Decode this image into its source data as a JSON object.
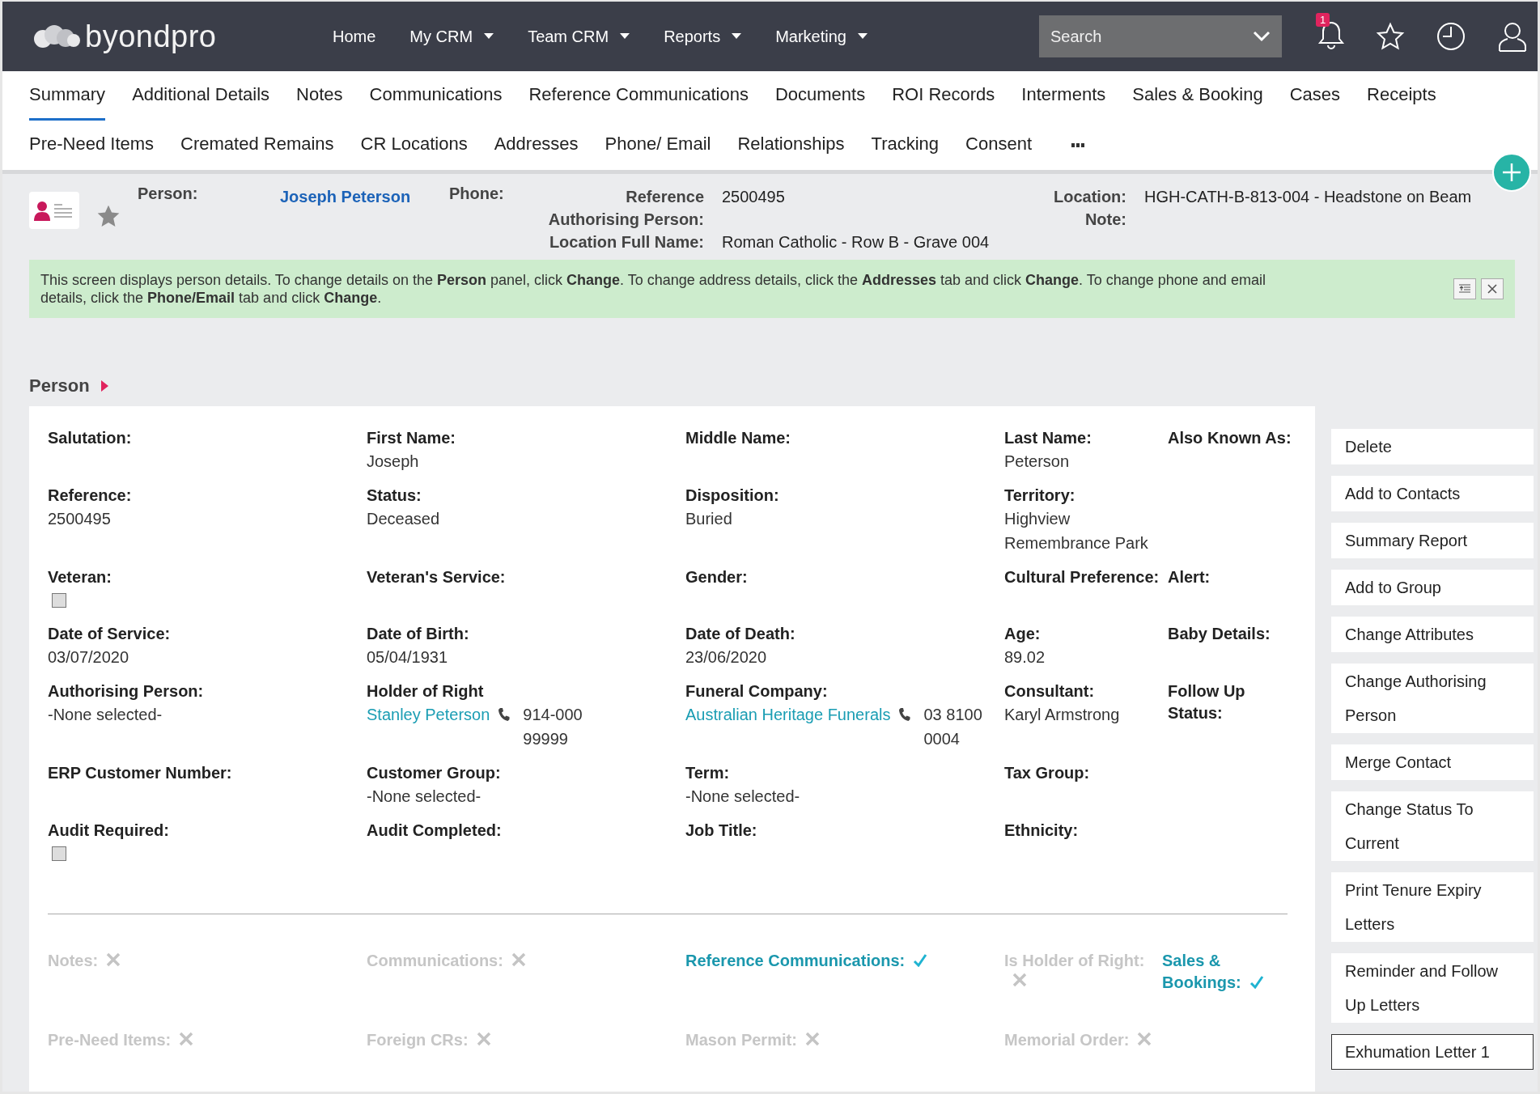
{
  "brand": {
    "name": "byondpro"
  },
  "nav": [
    {
      "label": "Home",
      "dropdown": false
    },
    {
      "label": "My CRM",
      "dropdown": true
    },
    {
      "label": "Team CRM",
      "dropdown": true
    },
    {
      "label": "Reports",
      "dropdown": true
    },
    {
      "label": "Marketing",
      "dropdown": true
    }
  ],
  "search": {
    "placeholder": "Search"
  },
  "notifications": {
    "badge": "1"
  },
  "tab_rows": [
    [
      {
        "label": "Summary",
        "selected": true
      },
      {
        "label": "Additional Details",
        "selected": false
      },
      {
        "label": "Notes",
        "selected": false
      },
      {
        "label": "Communications",
        "selected": false
      },
      {
        "label": "Reference Communications",
        "selected": false
      },
      {
        "label": "Documents",
        "selected": false
      },
      {
        "label": "ROI Records",
        "selected": false
      },
      {
        "label": "Interments",
        "selected": false
      },
      {
        "label": "Sales & Booking",
        "selected": false
      },
      {
        "label": "Cases",
        "selected": false
      },
      {
        "label": "Receipts",
        "selected": false
      }
    ],
    [
      {
        "label": "Pre-Need Items",
        "selected": false
      },
      {
        "label": "Cremated Remains",
        "selected": false
      },
      {
        "label": "CR Locations",
        "selected": false
      },
      {
        "label": "Addresses",
        "selected": false
      },
      {
        "label": "Phone/ Email",
        "selected": false
      },
      {
        "label": "Relationships",
        "selected": false
      },
      {
        "label": "Tracking",
        "selected": false
      },
      {
        "label": "Consent",
        "selected": false
      }
    ]
  ],
  "header": {
    "person_label": "Person:",
    "person_name": "Joseph Peterson",
    "phone_label": "Phone:",
    "details": [
      {
        "label": "Reference",
        "value": "2500495"
      },
      {
        "label": "Authorising Person:"
      },
      {
        "label": "Location Full Name:",
        "value": "Roman Catholic - Row B - Grave 004"
      }
    ],
    "location": [
      {
        "label": "Location:",
        "value": "HGH-CATH-B-813-004 - Headstone on Beam"
      },
      {
        "label": "Note:"
      }
    ]
  },
  "banner": {
    "text": "This screen displays person details. To change details on the **Person** panel, click **Change**. To change address details, click the **Addresses** tab and click **Change**. To change phone and email details, click the **Phone/Email** tab and click **Change**."
  },
  "section": {
    "title": "Person"
  },
  "fields": [
    [
      {
        "kind": "text",
        "label": "Salutation:"
      },
      {
        "kind": "text",
        "label": "First Name:",
        "value": "Joseph"
      },
      {
        "kind": "text",
        "label": "Middle Name:"
      },
      {
        "kind": "text",
        "label": "Last Name:",
        "value": "Peterson"
      },
      {
        "kind": "text",
        "label": "Also Known As:"
      }
    ],
    [
      {
        "kind": "text",
        "label": "Reference:",
        "value": "2500495"
      },
      {
        "kind": "text",
        "label": "Status:",
        "value": "Deceased"
      },
      {
        "kind": "text",
        "label": "Disposition:",
        "value": "Buried"
      },
      {
        "kind": "text",
        "label": "Territory:",
        "value": "Highview Remembrance Park"
      }
    ],
    [
      {
        "kind": "checkbox",
        "label": "Veteran:",
        "checked": false
      },
      {
        "kind": "text",
        "label": "Veteran's Service:"
      },
      {
        "kind": "text",
        "label": "Gender:"
      },
      {
        "kind": "text",
        "label": "Cultural Preference:"
      },
      {
        "kind": "text",
        "label": "Alert:"
      }
    ],
    [
      {
        "kind": "text",
        "label": "Date of Service:",
        "value": "03/07/2020"
      },
      {
        "kind": "text",
        "label": "Date of Birth:",
        "value": "05/04/1931"
      },
      {
        "kind": "text",
        "label": "Date of Death:",
        "value": "23/06/2020"
      },
      {
        "kind": "text",
        "label": "Age:",
        "value": "89.02"
      },
      {
        "kind": "text",
        "label": "Baby Details:"
      }
    ],
    [
      {
        "kind": "text",
        "label": "Authorising Person:",
        "value": "-None selected-"
      },
      {
        "kind": "contact",
        "label": "Holder of Right",
        "link": "Stanley Peterson",
        "phone": "914-000 99999"
      },
      {
        "kind": "contact",
        "label": "Funeral Company:",
        "link": "Australian Heritage Funerals",
        "phone": "03 8100 0004"
      },
      {
        "kind": "text",
        "label": "Consultant:",
        "value": "Karyl Armstrong"
      },
      {
        "kind": "text",
        "label": "Follow Up Status:"
      }
    ],
    [
      {
        "kind": "text",
        "label": "ERP Customer Number:"
      },
      {
        "kind": "text",
        "label": "Customer Group:",
        "value": "-None selected-"
      },
      {
        "kind": "text",
        "label": "Term:",
        "value": "-None selected-"
      },
      {
        "kind": "text",
        "label": "Tax Group:"
      }
    ],
    [
      {
        "kind": "checkbox",
        "label": "Audit Required:",
        "checked": false
      },
      {
        "kind": "text",
        "label": "Audit Completed:"
      },
      {
        "kind": "text",
        "label": "Job Title:"
      },
      {
        "kind": "text",
        "label": "Ethnicity:"
      }
    ]
  ],
  "flags": [
    [
      {
        "label": "Notes:",
        "on": false
      },
      {
        "label": "Communications:",
        "on": false
      },
      {
        "label": "Reference Communications:",
        "on": true
      },
      {
        "label": "Is Holder of Right:",
        "on": false
      },
      {
        "label": "Sales & Bookings:",
        "on": true
      }
    ],
    [
      {
        "label": "Pre-Need Items:",
        "on": false
      },
      {
        "label": "Foreign CRs:",
        "on": false
      },
      {
        "label": "Mason Permit:",
        "on": false
      },
      {
        "label": "Memorial Order:",
        "on": false
      }
    ]
  ],
  "actions": [
    {
      "label": "Delete",
      "focused": false
    },
    {
      "label": "Add to Contacts",
      "focused": false
    },
    {
      "label": "Summary Report",
      "focused": false
    },
    {
      "label": "Add to Group",
      "focused": false
    },
    {
      "label": "Change Attributes",
      "focused": false
    },
    {
      "label": "Change Authorising Person",
      "focused": false
    },
    {
      "label": "Merge Contact",
      "focused": false
    },
    {
      "label": "Change Status To Current",
      "focused": false
    },
    {
      "label": "Print Tenure Expiry Letters",
      "focused": false
    },
    {
      "label": "Reminder and Follow Up Letters",
      "focused": false
    },
    {
      "label": "Exhumation Letter 1",
      "focused": true
    }
  ]
}
